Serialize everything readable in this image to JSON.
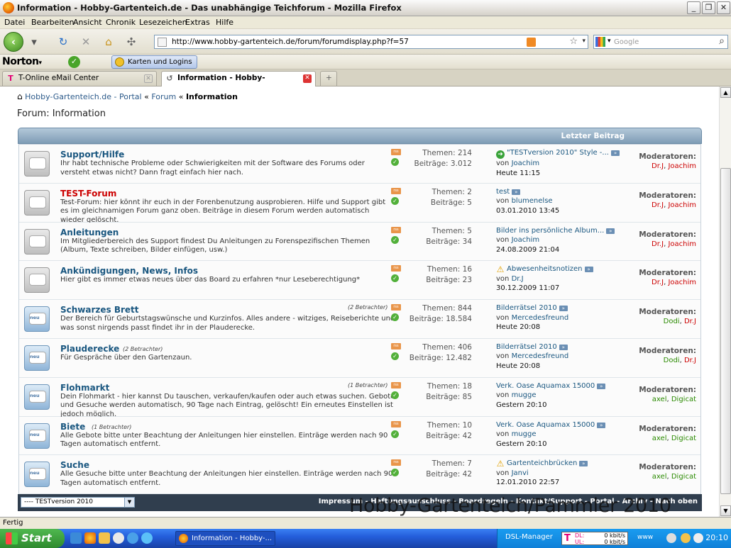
{
  "window": {
    "title": "Information - Hobby-Gartenteich.de - Das unabhängige Teichforum - Mozilla Firefox"
  },
  "menu": [
    "Datei",
    "Bearbeiten",
    "Ansicht",
    "Chronik",
    "Lesezeichen",
    "Extras",
    "Hilfe"
  ],
  "url": "http://www.hobby-gartenteich.de/forum/forumdisplay.php?f=57",
  "search_placeholder": "Google",
  "norton": {
    "brand": "Norton",
    "karten_label": "Karten und Logins"
  },
  "tabs": [
    {
      "label": "T-Online eMail Center"
    },
    {
      "label": "Information - Hobby-Gartenteich..."
    }
  ],
  "breadcrumb": {
    "portal": "Hobby-Gartenteich.de - Portal",
    "forum": "Forum",
    "current": "Information"
  },
  "page_title": "Forum: Information",
  "header": {
    "last_post_label": "Letzter Beitrag"
  },
  "forums": [
    {
      "name": "Support/Hilfe",
      "desc": "Ihr habt technische Probleme oder Schwierigkeiten mit der Software des Forums oder versteht etwas nicht? Dann fragt einfach hier nach.",
      "viewers": "",
      "themen": "Themen: 214",
      "beitraege": "Beiträge: 3.012",
      "last_title": "\"TESTversion 2010\" Style -...",
      "last_by": "Joachim",
      "last_time": "Heute 11:15",
      "mods": [
        "Dr.J",
        "Joachim"
      ]
    },
    {
      "name": "TEST-Forum",
      "desc": "Test-Forum: hier könnt ihr euch in der Forenbenutzung ausprobieren. Hilfe und Support gibt es im gleichnamigen Forum ganz oben. Beiträge in diesem Forum werden automatisch wieder gelöscht.",
      "viewers": "",
      "themen": "Themen: 2",
      "beitraege": "Beiträge: 5",
      "last_title": "test",
      "last_by": "blumenelse",
      "last_time": "03.01.2010 13:45",
      "mods": [
        "Dr.J",
        "Joachim"
      ]
    },
    {
      "name": "Anleitungen",
      "desc": "Im Mitgliederbereich des Support findest Du Anleitungen zu Forenspezifischen Themen (Album, Texte schreiben, Bilder einfügen, usw.)",
      "viewers": "",
      "themen": "Themen: 5",
      "beitraege": "Beiträge: 34",
      "last_title": "Bilder ins persönliche Album...",
      "last_by": "Joachim",
      "last_time": "24.08.2009 21:04",
      "mods": [
        "Dr.J",
        "Joachim"
      ]
    },
    {
      "name": "Ankündigungen, News, Infos",
      "desc": "Hier gibt es immer etwas neues über das Board zu erfahren *nur Leseberechtigung*",
      "viewers": "",
      "themen": "Themen: 16",
      "beitraege": "Beiträge: 23",
      "last_title": "Abwesenheitsnotizen",
      "last_by": "Dr.J",
      "last_time": "30.12.2009 11:07",
      "mods": [
        "Dr.J",
        "Joachim"
      ]
    },
    {
      "name": "Schwarzes Brett",
      "desc": "Der Bereich für Geburtstagswünsche und Kurzinfos. Alles andere - witziges, Reiseberichte und was sonst nirgends passt findet ihr in der Plauderecke.",
      "viewers": "(2 Betrachter)",
      "themen": "Themen: 844",
      "beitraege": "Beiträge: 18.584",
      "last_title": "Bilderrätsel 2010",
      "last_by": "Mercedesfreund",
      "last_time": "Heute 20:08",
      "mods": [
        "Dodi",
        "Dr.J"
      ]
    },
    {
      "name": "Plauderecke",
      "desc": "Für Gespräche über den Gartenzaun.",
      "viewers": "(2 Betrachter)",
      "themen": "Themen: 406",
      "beitraege": "Beiträge: 12.482",
      "last_title": "Bilderrätsel 2010",
      "last_by": "Mercedesfreund",
      "last_time": "Heute 20:08",
      "mods": [
        "Dodi",
        "Dr.J"
      ]
    },
    {
      "name": "Flohmarkt",
      "desc": "Dein Flohmarkt - hier kannst Du tauschen, verkaufen/kaufen oder auch etwas suchen. Gebote und Gesuche werden automatisch, 90 Tage nach Eintrag, gelöscht! Ein erneutes Einstellen ist jedoch möglich.",
      "viewers": "(1 Betrachter)",
      "themen": "Themen: 18",
      "beitraege": "Beiträge: 85",
      "last_title": "Verk. Oase Aquamax 15000",
      "last_by": "mugge",
      "last_time": "Gestern 20:10",
      "mods": [
        "axel",
        "Digicat"
      ]
    },
    {
      "name": "Biete",
      "desc": "Alle Gebote bitte unter Beachtung der Anleitungen hier einstellen. Einträge werden nach 90 Tagen automatisch entfernt.",
      "viewers": "(1 Betrachter)",
      "themen": "Themen: 10",
      "beitraege": "Beiträge: 42",
      "last_title": "Verk. Oase Aquamax 15000",
      "last_by": "mugge",
      "last_time": "Gestern 20:10",
      "mods": [
        "axel",
        "Digicat"
      ]
    },
    {
      "name": "Suche",
      "desc": "Alle Gesuche bitte unter Beachtung der Anleitungen hier einstellen. Einträge werden nach 90 Tagen automatisch entfernt.",
      "viewers": "",
      "themen": "Themen: 7",
      "beitraege": "Beiträge: 42",
      "last_title": "Gartenteichbrücken",
      "last_by": "Janvi",
      "last_time": "12.01.2010 22:57",
      "mods": [
        "axel",
        "Digicat"
      ]
    }
  ],
  "labels": {
    "moderators": "Moderatoren:",
    "by": "von",
    "sep": ","
  },
  "footer": {
    "style_select": "---- TESTversion 2010",
    "links": "Impressum - Haftungsausschluss - Boardregeln - Kontakt/Support - Portal - Archiv - Nach oben"
  },
  "watermark": "Hobby-Gartenteich/Pammler 2010",
  "status": "Fertig",
  "taskbar": {
    "start": "Start",
    "task": "Information - Hobby-...",
    "dsl": "DSL-Manager",
    "dl_label": "DL:",
    "ul_label": "UL:",
    "dl": "0 kbit/s",
    "ul": "0 kbit/s",
    "www": "www",
    "clock": "20:10"
  }
}
